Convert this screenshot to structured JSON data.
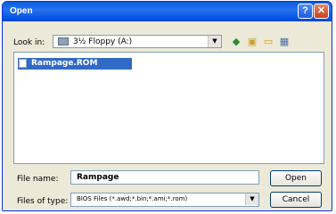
{
  "dialog": {
    "title": "Open",
    "help_button": "?",
    "close_button": "✕"
  },
  "look_in": {
    "label": "Look in:",
    "value": "3½ Floppy (A:)"
  },
  "toolbar": {
    "back_icon": "back-arrow-icon",
    "up_icon": "up-folder-icon",
    "new_folder_icon": "new-folder-icon",
    "views_icon": "views-menu-icon"
  },
  "files": [
    {
      "name": "Rampage.ROM",
      "selected": true
    }
  ],
  "file_name": {
    "label": "File name:",
    "value": "Rampage"
  },
  "file_type": {
    "label": "Files of type:",
    "value": "BIOS Files (*.awd;*.bin;*.ami;*.rom)"
  },
  "buttons": {
    "open": "Open",
    "cancel": "Cancel"
  },
  "colors": {
    "titlebar": "#0054e3",
    "selection": "#316ac5",
    "dialog_bg": "#ece9d8"
  }
}
